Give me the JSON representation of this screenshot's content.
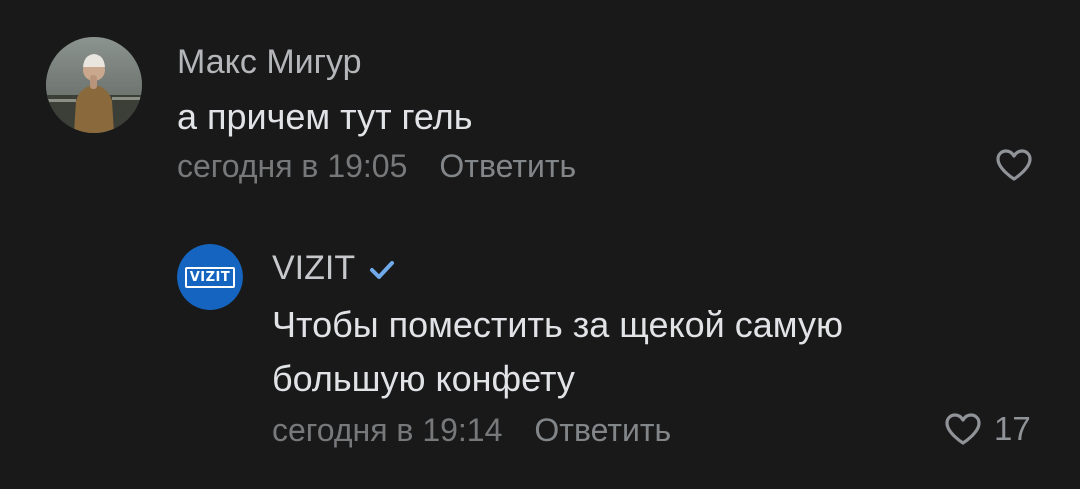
{
  "comments": [
    {
      "author": "Макс Мигур",
      "avatar": "user-photo-avatar",
      "text_lines": [
        "а причем тут гель"
      ],
      "time": "сегодня в 19:05",
      "reply_label": "Ответить",
      "likes": "",
      "verified": false
    },
    {
      "author": "VIZIT",
      "avatar": "vizit-logo-avatar",
      "avatar_text": "VIZIT",
      "text_lines": [
        "Чтобы поместить за щекой самую",
        "большую конфету"
      ],
      "time": "сегодня в 19:14",
      "reply_label": "Ответить",
      "likes": "17",
      "verified": true
    }
  ],
  "colors": {
    "background": "#19191a",
    "author": "#b4b6ba",
    "text": "#e1e3e6",
    "meta": "#76787a",
    "verified": "#71aaeb",
    "vizit_brand": "#1565c0"
  },
  "icons": [
    "heart-icon",
    "verified-check-icon"
  ]
}
